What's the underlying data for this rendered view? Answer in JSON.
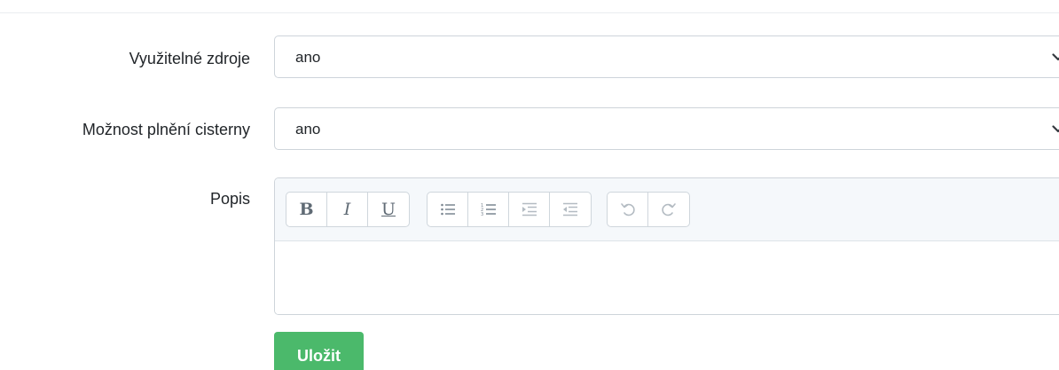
{
  "form": {
    "fields": [
      {
        "label": "Využitelné zdroje",
        "value": "ano"
      },
      {
        "label": "Možnost plnění cisterny",
        "value": "ano"
      }
    ],
    "description": {
      "label": "Popis",
      "toolbar": {
        "bold": "B",
        "italic": "I",
        "underline": "U"
      },
      "content": ""
    },
    "save_label": "Uložit"
  },
  "colors": {
    "save_button": "#4bb96b",
    "toolbar_bg": "#f5f8fb",
    "border": "#ced4da"
  }
}
